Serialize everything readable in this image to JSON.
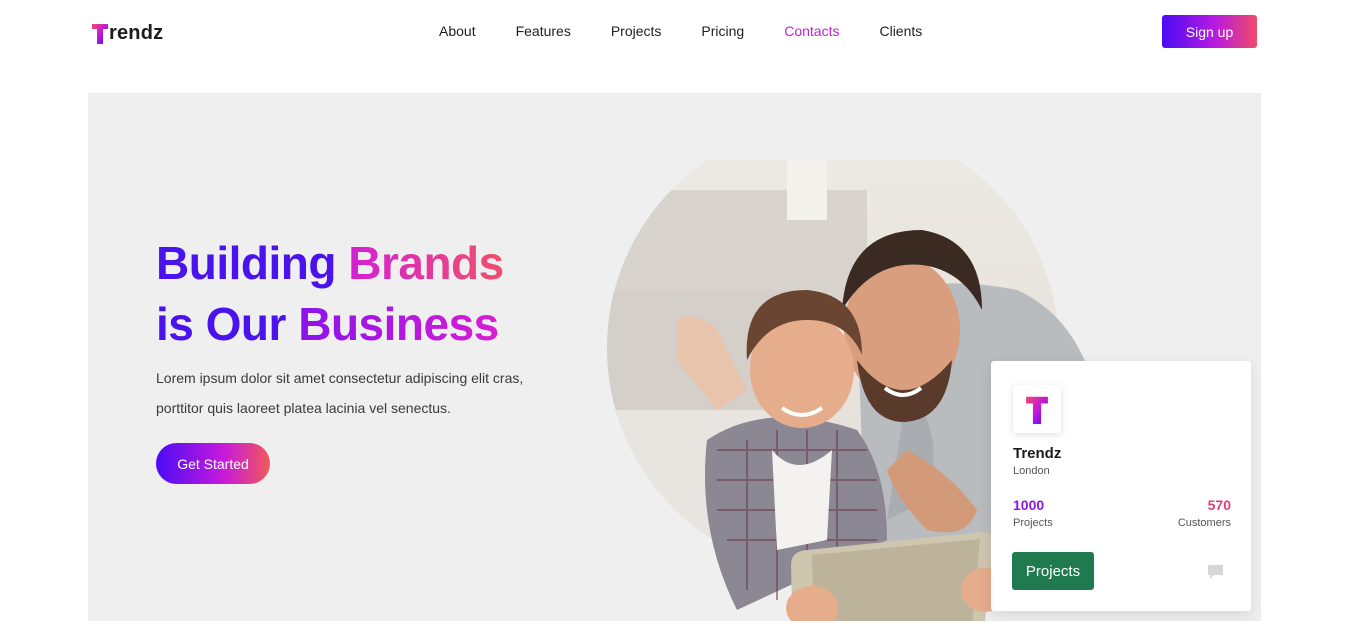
{
  "brand": {
    "logo_letter": "T",
    "name_rest": "rendz"
  },
  "nav": {
    "items": [
      {
        "label": "About"
      },
      {
        "label": "Features"
      },
      {
        "label": "Projects"
      },
      {
        "label": "Pricing"
      },
      {
        "label": "Contacts",
        "active": true
      },
      {
        "label": "Clients"
      }
    ],
    "signup_label": "Sign up"
  },
  "hero": {
    "headline": {
      "line1_part1": "Building",
      "line1_part2": "Brands",
      "line2_part1": "is Our",
      "line2_part2": "Business"
    },
    "description_line1": "Lorem ipsum dolor sit amet consectetur adipiscing elit cras,",
    "description_line2": "porttitor quis laoreet platea lacinia vel senectus.",
    "cta_label": "Get Started"
  },
  "card": {
    "title": "Trendz",
    "location": "London",
    "stats": [
      {
        "value": "1000",
        "label": "Projects"
      },
      {
        "value": "570",
        "label": "Customers"
      }
    ],
    "button_label": "Projects"
  },
  "colors": {
    "accent_blue": "#4a13ec",
    "accent_pink": "#d51fd0",
    "accent_coral": "#f0506a",
    "nav_active": "#c41fd6",
    "card_button": "#1f7a50",
    "hero_bg": "#efefef"
  }
}
